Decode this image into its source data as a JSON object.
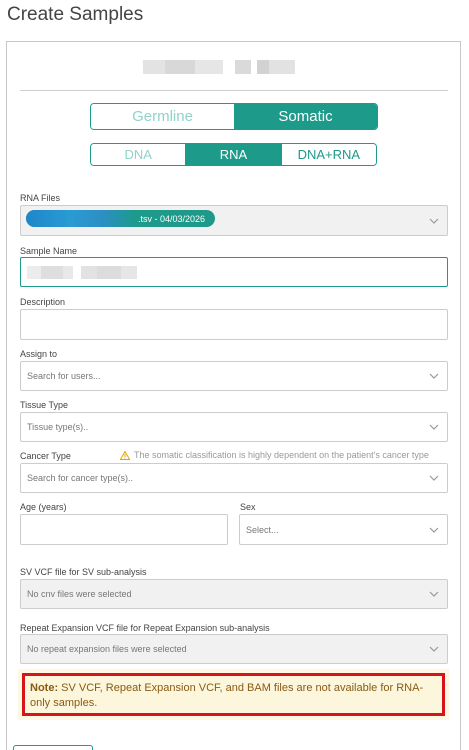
{
  "page": {
    "title": "Create Samples"
  },
  "sample_type_toggle": {
    "options": [
      "Germline",
      "Somatic"
    ],
    "selected": "Somatic"
  },
  "analyte_toggle": {
    "options": [
      "DNA",
      "RNA",
      "DNA+RNA"
    ],
    "selected": "RNA"
  },
  "rna_files": {
    "label": "RNA Files",
    "chip_text": ".tsv - 04/03/2026"
  },
  "sample_name": {
    "label": "Sample Name"
  },
  "description": {
    "label": "Description"
  },
  "assign_to": {
    "label": "Assign to",
    "placeholder": "Search for users..."
  },
  "tissue_type": {
    "label": "Tissue Type",
    "placeholder": "Tissue type(s).."
  },
  "cancer_type": {
    "label": "Cancer Type",
    "warning": "The somatic classification is highly dependent on the patient's cancer type",
    "placeholder": "Search for cancer type(s).."
  },
  "age": {
    "label": "Age (years)"
  },
  "sex": {
    "label": "Sex",
    "placeholder": "Select..."
  },
  "sv_vcf": {
    "label": "SV VCF file for SV sub-analysis",
    "value": "No cnv files were selected"
  },
  "repeat_vcf": {
    "label": "Repeat Expansion VCF file for Repeat Expansion sub-analysis",
    "value": "No repeat expansion files were selected"
  },
  "note": {
    "prefix": "Note:",
    "text": " SV VCF, Repeat Expansion VCF, and BAM files are not available for RNA-only samples."
  },
  "colors": {
    "accent": "#1d9a8a",
    "warning_border": "#d7141a",
    "note_bg": "#fcf6dc"
  },
  "icons": [
    "chevron-down-icon",
    "warning-icon"
  ]
}
